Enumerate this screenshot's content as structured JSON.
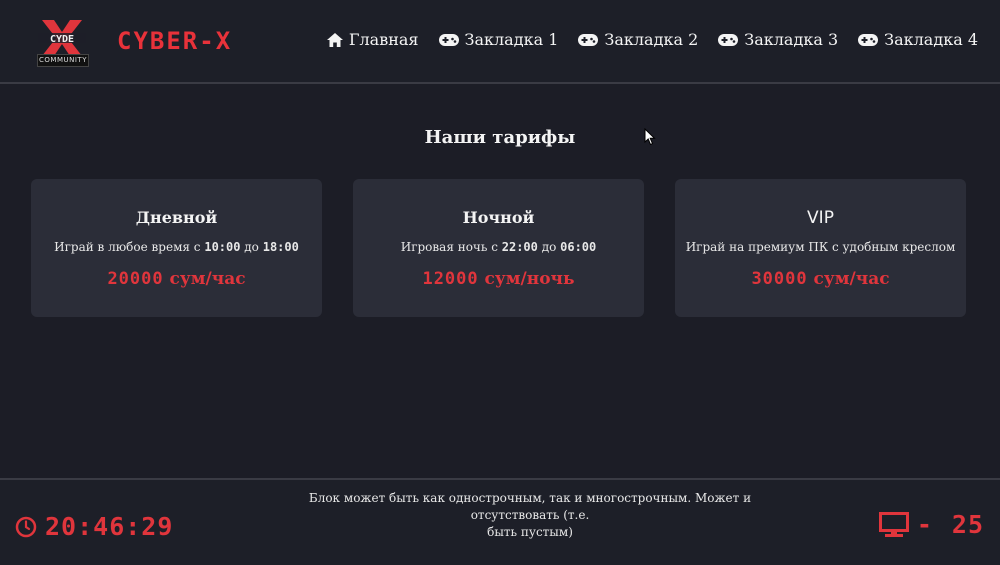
{
  "header": {
    "logo_badge": "COMMUNITY",
    "brand": "CYBER-X",
    "nav": [
      {
        "icon": "home-icon",
        "label": "Главная"
      },
      {
        "icon": "gamepad-icon",
        "label": "Закладка 1"
      },
      {
        "icon": "gamepad-icon",
        "label": "Закладка 2"
      },
      {
        "icon": "gamepad-icon",
        "label": "Закладка 3"
      },
      {
        "icon": "gamepad-icon",
        "label": "Закладка 4"
      }
    ]
  },
  "main": {
    "title": "Наши тарифы",
    "cards": [
      {
        "title": "Дневной",
        "desc_prefix": "Играй в любое время с ",
        "time_from": "10:00",
        "desc_mid": " до ",
        "time_to": "18:00",
        "price_value": "20000",
        "price_unit": " сум/час"
      },
      {
        "title": "Ночной",
        "desc_prefix": "Игровая ночь с ",
        "time_from": "22:00",
        "desc_mid": " до ",
        "time_to": "06:00",
        "price_value": "12000",
        "price_unit": " сум/ночь"
      },
      {
        "title": "VIP",
        "desc": "Играй на премиум ПК с удобным креслом",
        "price_value": "30000",
        "price_unit": " сум/час"
      }
    ]
  },
  "footer": {
    "clock": "20:46:29",
    "note_line1": "Блок может быть как однострочным, так и многострочным. Может и отсутствовать (т.е.",
    "note_line2": "быть пустым)",
    "pc_dash": "-",
    "pc_count": "25"
  },
  "colors": {
    "background": "#1c1d26",
    "card": "#2b2d38",
    "accent": "#e0353c"
  }
}
